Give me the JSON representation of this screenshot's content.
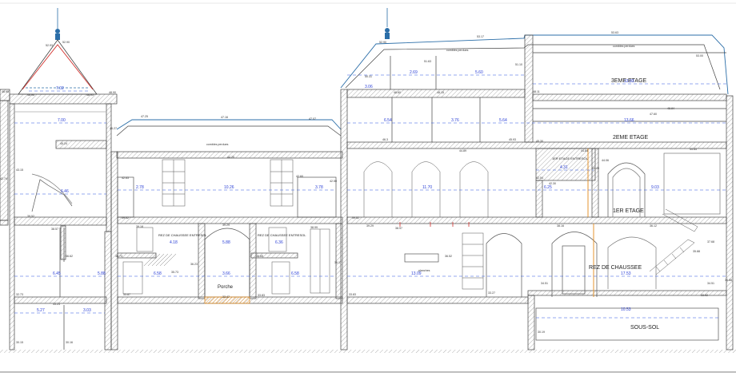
{
  "rooms": {
    "troisieme": "3EME ETAGE",
    "deuxieme": "2EME ETAGE",
    "premier": "1ER ETAGE",
    "entresol_premier": "1ER ETAGE ENTRESOL",
    "rez_chaussee": "REZ DE CHAUSSEE",
    "rez_entresol_left": "REZ DE CHAUSSEE ENTRESOL",
    "rez_entresol_right": "REZ DE CHAUSSEE ENTRESOL",
    "porche": "Porche",
    "sous_sol": "SOUS-SOL"
  },
  "notes": {
    "comble_left": "combles perdues",
    "comble_right1": "combles perdues",
    "comble_right2": "combles perdues",
    "planches": "planches"
  },
  "heights": {
    "h1": "7.02",
    "h2": "7.00",
    "h3": "6.46",
    "h4": "6.45",
    "h5": "5.27",
    "h6": "3.03",
    "h7": "2.78",
    "h8": "10.26",
    "h9": "3.78",
    "h10": "4.18",
    "h11": "5.88",
    "h12": "6.58",
    "h13": "6.36",
    "h14": "6.58",
    "h15": "3.66",
    "h16": "5.88",
    "h17": "3.06",
    "h18": "2.69",
    "h19": "5.60",
    "h20": "6.54",
    "h21": "3.76",
    "h22": "5.64",
    "h23": "11.70",
    "h24": "13.09",
    "h25": "13.93",
    "h26": "13.66",
    "h27": "6.25",
    "h28": "9.03",
    "h29": "4.31",
    "h30": "17.53",
    "h31": "10.53"
  },
  "levels": {
    "l1": "52.93",
    "l2": "52.90",
    "l3": "48.95",
    "l4": "48.96",
    "l5": "48.93",
    "l6": "48.90",
    "l7": "46.27",
    "l8": "45.24",
    "l9": "43.15",
    "l10": "42.74",
    "l11": "39.52",
    "l12": "38.57",
    "l13": "36.62",
    "l14": "32.73",
    "l15": "33.23",
    "l16": "30.15",
    "l17": "30.16",
    "l18": "47.25",
    "l19": "47.16",
    "l20": "47.07",
    "l21": "44.20",
    "l22": "42.63",
    "l23": "42.60",
    "l24": "42.50",
    "l25": "39.52",
    "l26": "39.29",
    "l27": "39.18",
    "l28": "38.99",
    "l29": "36.73",
    "l30": "36.65",
    "l31": "36.23",
    "l32": "36.17",
    "l33": "35.73",
    "l34": "33.47",
    "l35": "33.83",
    "l36": "33.83",
    "l37": "33.87",
    "l38": "53.17",
    "l39": "53.63",
    "l40": "52.90",
    "l41": "53.00",
    "l42": "51.63",
    "l43": "51.10",
    "l44": "50.31",
    "l45": "48.60",
    "l46": "48.15",
    "l47": "48.11",
    "l48": "47.60",
    "l49": "46.3",
    "l50": "45.93",
    "l51": "44.89",
    "l52": "44.84",
    "l53": "44.06",
    "l54": "43.49",
    "l55": "42.54",
    "l56": "42.30",
    "l57": "39.52",
    "l58": "39.29",
    "l59": "38.97",
    "l60": "38.16",
    "l61": "36.12",
    "l62": "37.68",
    "l63": "35.88",
    "l64": "36.52",
    "l65": "34.51",
    "l66": "34.51",
    "l67": "34.88",
    "l68": "33.27",
    "l69": "33.92",
    "l70": "30.19",
    "l71": "48.84",
    "l72": "45.30",
    "l73": "44.65"
  }
}
